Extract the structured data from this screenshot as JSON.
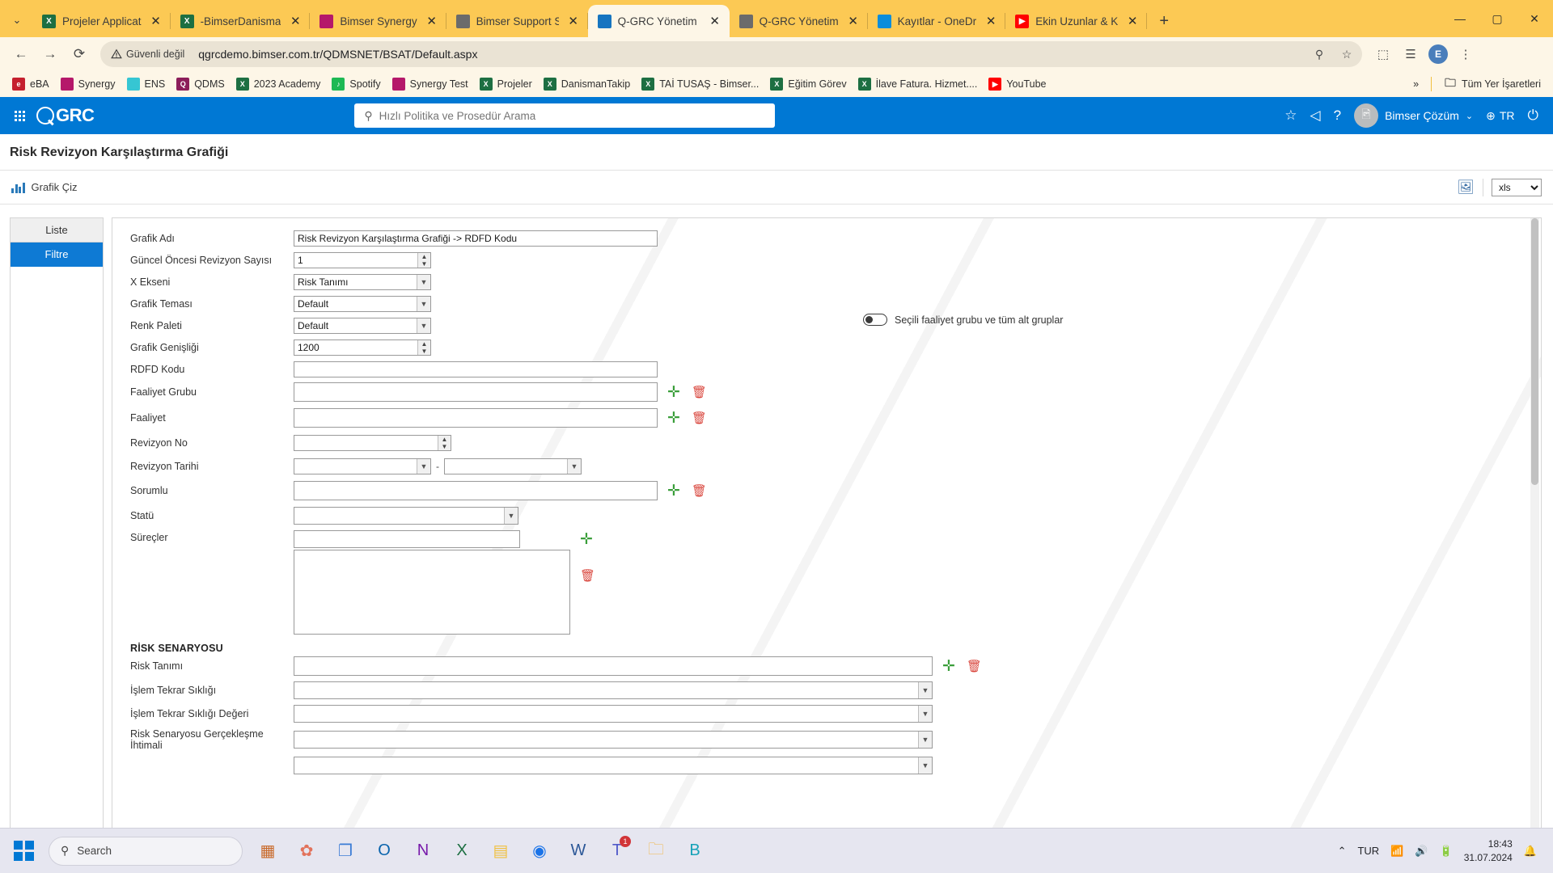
{
  "browser": {
    "tab_list_icon": "chevron-down-icon",
    "new_tab_label": "+",
    "tabs": [
      {
        "title": "Projeler Applicat",
        "favicon": "excel-icon",
        "color": "#1d6f42",
        "glyph": "X",
        "active": false
      },
      {
        "title": "-BimserDanisma",
        "favicon": "excel-icon",
        "color": "#1d6f42",
        "glyph": "X",
        "active": false
      },
      {
        "title": "Bimser Synergy",
        "favicon": "synergy-icon",
        "color": "#b5186a",
        "glyph": "",
        "active": false
      },
      {
        "title": "Bimser Support S",
        "favicon": "globe-icon",
        "color": "#6b6b6b",
        "glyph": "",
        "active": false
      },
      {
        "title": "Q-GRC Yönetim S",
        "favicon": "qgrc-icon",
        "color": "#1675c0",
        "glyph": "",
        "active": true
      },
      {
        "title": "Q-GRC Yönetim",
        "favicon": "globe-icon",
        "color": "#6b6b6b",
        "glyph": "",
        "active": false
      },
      {
        "title": "Kayıtlar - OneDr",
        "favicon": "onedrive-icon",
        "color": "#0b8ddb",
        "glyph": "",
        "active": false
      },
      {
        "title": "Ekin Uzunlar & K",
        "favicon": "youtube-icon",
        "color": "#ff0000",
        "glyph": "▶",
        "active": false
      }
    ],
    "window_controls": {
      "minimize": "—",
      "maximize": "▢",
      "close": "✕"
    },
    "omnibox": {
      "back_icon": "back-arrow-icon",
      "forward_icon": "forward-arrow-icon",
      "reload_icon": "reload-icon",
      "security_label": "Güvenli değil",
      "security_icon": "warning-triangle-icon",
      "url": "qgrcdemo.bimser.com.tr/QDMSNET/BSAT/Default.aspx",
      "zoom_icon": "zoom-magnifier-icon",
      "bookmark_icon": "star-outline-icon",
      "extensions_icon": "puzzle-piece-icon",
      "reading_list_icon": "reading-list-icon",
      "profile_initial": "E",
      "menu_icon": "kebab-menu-icon"
    },
    "bookmarks": [
      {
        "label": "eBA",
        "color": "#c5202e",
        "glyph": "e"
      },
      {
        "label": "Synergy",
        "color": "#b5186a",
        "glyph": ""
      },
      {
        "label": "ENS",
        "color": "#36c6d3",
        "glyph": ""
      },
      {
        "label": "QDMS",
        "color": "#8c1d5a",
        "glyph": "Q"
      },
      {
        "label": "2023 Academy",
        "color": "#1d6f42",
        "glyph": "X"
      },
      {
        "label": "Spotify",
        "color": "#1db954",
        "glyph": "♪"
      },
      {
        "label": "Synergy Test",
        "color": "#b5186a",
        "glyph": ""
      },
      {
        "label": "Projeler",
        "color": "#1d6f42",
        "glyph": "X"
      },
      {
        "label": "DanismanTakip",
        "color": "#1d6f42",
        "glyph": "X"
      },
      {
        "label": "TAİ TUSAŞ - Bimser...",
        "color": "#1d6f42",
        "glyph": "X"
      },
      {
        "label": "Eğitim Görev",
        "color": "#1d6f42",
        "glyph": "X"
      },
      {
        "label": "İlave Fatura. Hizmet....",
        "color": "#1d6f42",
        "glyph": "X"
      },
      {
        "label": "YouTube",
        "color": "#ff0000",
        "glyph": "▶"
      }
    ],
    "bookmarks_overflow": "»",
    "all_bookmarks_label": "Tüm Yer İşaretleri",
    "all_bookmarks_icon": "folder-icon"
  },
  "app": {
    "header": {
      "apps_icon": "app-grid-icon",
      "brand": "GRC",
      "search_placeholder": "Hızlı Politika ve Prosedür Arama",
      "search_icon": "search-icon",
      "favorites_icon": "star-icon",
      "announce_icon": "megaphone-icon",
      "help_icon": "question-mark-icon",
      "user_name": "Bimser Çözüm",
      "user_chevron": "chevron-down-icon",
      "avatar_icon": "avatar-placeholder-icon",
      "language": "TR",
      "language_icon": "translate-icon",
      "power_icon": "power-icon",
      "accent_color": "#0078d4"
    },
    "page_title": "Risk Revizyon Karşılaştırma Grafiği",
    "toolbar": {
      "draw_chart_label": "Grafik Çiz",
      "draw_chart_icon": "bar-chart-icon",
      "export_image_icon": "export-image-icon",
      "export_format": "xls"
    },
    "left_nav": [
      {
        "label": "Liste",
        "active": false
      },
      {
        "label": "Filtre",
        "active": true
      }
    ],
    "toggle": {
      "label": "Seçili faaliyet grubu ve tüm alt gruplar",
      "checked": false
    },
    "form": {
      "grafik_adi": {
        "label": "Grafik Adı",
        "value": "Risk Revizyon Karşılaştırma Grafiği -> RDFD Kodu"
      },
      "guncel_oncesi": {
        "label": "Güncel Öncesi Revizyon Sayısı",
        "value": "1"
      },
      "x_ekseni": {
        "label": "X Ekseni",
        "value": "Risk Tanımı"
      },
      "grafik_temasi": {
        "label": "Grafik Teması",
        "value": "Default"
      },
      "renk_paleti": {
        "label": "Renk Paleti",
        "value": "Default"
      },
      "grafik_genisligi": {
        "label": "Grafik Genişliği",
        "value": "1200"
      },
      "rdfd_kodu": {
        "label": "RDFD Kodu",
        "value": ""
      },
      "faaliyet_grubu": {
        "label": "Faaliyet Grubu",
        "value": ""
      },
      "faaliyet": {
        "label": "Faaliyet",
        "value": ""
      },
      "revizyon_no": {
        "label": "Revizyon No",
        "value": ""
      },
      "revizyon_tarihi": {
        "label": "Revizyon Tarihi",
        "value_from": "",
        "value_to": "",
        "separator": "-"
      },
      "sorumlu": {
        "label": "Sorumlu",
        "value": ""
      },
      "statu": {
        "label": "Statü",
        "value": ""
      },
      "surecler": {
        "label": "Süreçler",
        "value": "",
        "list_value": ""
      },
      "section_risk": "RİSK SENARYOSU",
      "risk_tanimi": {
        "label": "Risk Tanımı",
        "value": ""
      },
      "islem_tekrar_sikligi": {
        "label": "İşlem Tekrar Sıklığı",
        "value": ""
      },
      "islem_tekrar_sikligi_degeri": {
        "label": "İşlem Tekrar Sıklığı Değeri",
        "value": ""
      },
      "risk_senaryosu_gerceklesme": {
        "label": "Risk Senaryosu Gerçekleşme İhtimali",
        "value": ""
      },
      "add_icon": "plus-icon",
      "delete_icon": "trash-icon"
    }
  },
  "taskbar": {
    "start_icon": "windows-start-icon",
    "search_placeholder": "Search",
    "search_icon": "search-icon",
    "items": [
      {
        "name": "widgets-icon",
        "glyph": "▦",
        "color": "#c96a2b"
      },
      {
        "name": "paint-icon",
        "glyph": "✿",
        "color": "#e2725b"
      },
      {
        "name": "task-view-icon",
        "glyph": "❐",
        "color": "#3a7bd5"
      },
      {
        "name": "outlook-icon",
        "glyph": "O",
        "color": "#0a64ad"
      },
      {
        "name": "onenote-icon",
        "glyph": "N",
        "color": "#7719aa"
      },
      {
        "name": "excel-icon",
        "glyph": "X",
        "color": "#1d6f42"
      },
      {
        "name": "sticky-notes-icon",
        "glyph": "▤",
        "color": "#f0c040"
      },
      {
        "name": "chrome-icon",
        "glyph": "◉",
        "color": "#1a73e8"
      },
      {
        "name": "word-icon",
        "glyph": "W",
        "color": "#2b5797"
      },
      {
        "name": "teams-icon",
        "glyph": "T",
        "color": "#5059c9",
        "badge": "1"
      },
      {
        "name": "file-explorer-icon",
        "glyph": "🗀",
        "color": "#f2b544"
      },
      {
        "name": "bimser-icon",
        "glyph": "B",
        "color": "#17a2b8"
      }
    ],
    "tray": {
      "chevron_icon": "chevron-up-icon",
      "language": "TUR",
      "wifi_icon": "wifi-icon",
      "volume_icon": "speaker-icon",
      "battery_icon": "battery-icon",
      "time": "18:43",
      "date": "31.07.2024",
      "notification_icon": "bell-icon"
    }
  }
}
